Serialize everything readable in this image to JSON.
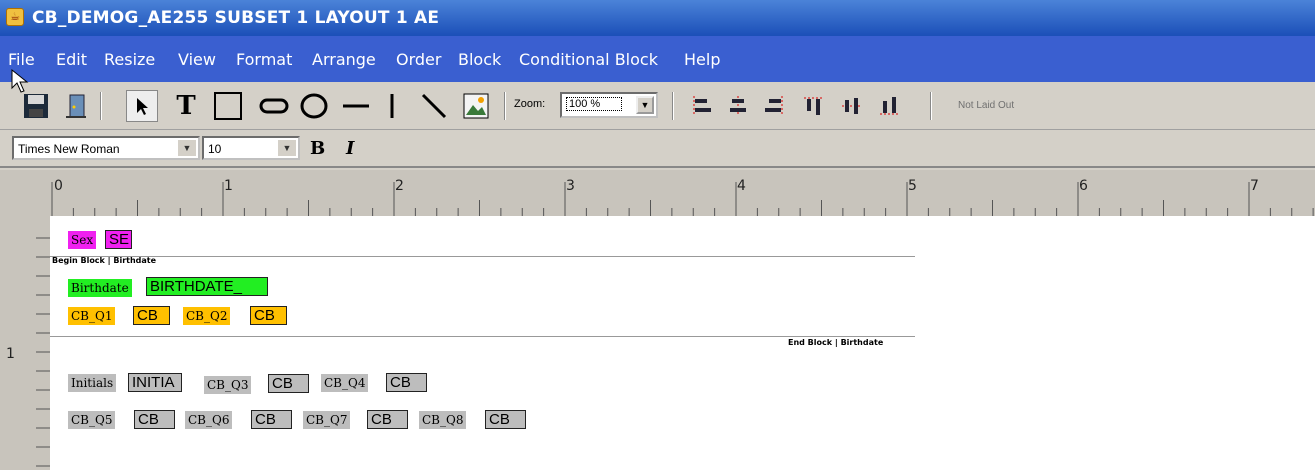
{
  "window": {
    "title": "CB_DEMOG_AE255 SUBSET 1 LAYOUT 1 AE"
  },
  "menu": [
    {
      "label": "File"
    },
    {
      "label": "Edit"
    },
    {
      "label": "Resize"
    },
    {
      "label": "View"
    },
    {
      "label": "Format"
    },
    {
      "label": "Arrange"
    },
    {
      "label": "Order"
    },
    {
      "label": "Block"
    },
    {
      "label": "Conditional Block"
    },
    {
      "label": "Help"
    }
  ],
  "toolbar": {
    "zoom_label": "Zoom:",
    "zoom_value": "100 %",
    "layout_status": "Not Laid Out"
  },
  "formatbar": {
    "font": "Times New Roman",
    "size": "10",
    "bold": "B",
    "italic": "I"
  },
  "ruler": {
    "h_labels": [
      "0",
      "1",
      "2",
      "3",
      "4",
      "5",
      "6",
      "7"
    ],
    "v_labels": [
      "1"
    ]
  },
  "canvas": {
    "sex_label": "Sex",
    "sex_field": "SE",
    "block_begin": "Begin Block | Birthdate",
    "birthdate_label": "Birthdate",
    "birthdate_field": "BIRTHDATE_",
    "cb_q1_label": "CB_Q1",
    "cb_q1_field": "CB",
    "cb_q2_label": "CB_Q2",
    "cb_q2_field": "CB",
    "block_end": "End Block | Birthdate",
    "initials_label": "Initials",
    "initials_field": "INITIA",
    "cb_q3_label": "CB_Q3",
    "cb_q3_field": "CB",
    "cb_q4_label": "CB_Q4",
    "cb_q4_field": "CB",
    "cb_q5_label": "CB_Q5",
    "cb_q5_field": "CB",
    "cb_q6_label": "CB_Q6",
    "cb_q6_field": "CB",
    "cb_q7_label": "CB_Q7",
    "cb_q7_field": "CB",
    "cb_q8_label": "CB_Q8",
    "cb_q8_field": "CB"
  },
  "colors": {
    "label_magenta": "#f020f0",
    "label_green": "#22ee22",
    "label_yellow": "#ffc000",
    "label_gray": "#bdbdbd"
  }
}
